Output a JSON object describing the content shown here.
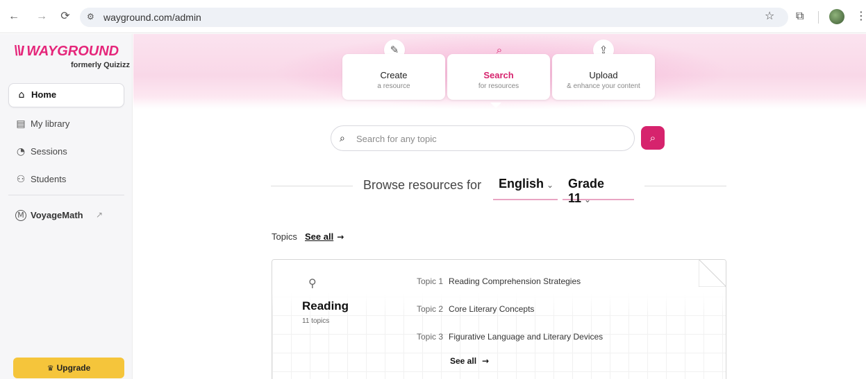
{
  "browser": {
    "url": "wayground.com/admin"
  },
  "brand": {
    "name": "WAYGROUND",
    "tagline": "formerly Quizizz",
    "accent": "#d6236d"
  },
  "sidebar": {
    "items": [
      {
        "label": "Home",
        "icon": "home-icon"
      },
      {
        "label": "My library",
        "icon": "library-icon"
      },
      {
        "label": "Sessions",
        "icon": "sessions-icon"
      },
      {
        "label": "Students",
        "icon": "students-icon"
      },
      {
        "label": "VoyageMath",
        "icon": "voyagemath-icon"
      }
    ],
    "upgrade_label": "Upgrade"
  },
  "actions": [
    {
      "title": "Create",
      "desc": "a resource",
      "icon": "pencil-icon"
    },
    {
      "title": "Search",
      "desc": "for resources",
      "icon": "search-icon"
    },
    {
      "title": "Upload",
      "desc": "& enhance your content",
      "icon": "upload-icon"
    }
  ],
  "search": {
    "placeholder": "Search for any topic"
  },
  "browse": {
    "label": "Browse resources for",
    "subject": "English",
    "grade": "Grade 11"
  },
  "topics": {
    "label": "Topics",
    "see_all": "See all",
    "card": {
      "subject": "Reading",
      "count": "11 topics",
      "rows": [
        {
          "num": "Topic 1",
          "name": "Reading Comprehension Strategies"
        },
        {
          "num": "Topic 2",
          "name": "Core Literary Concepts"
        },
        {
          "num": "Topic 3",
          "name": "Figurative Language and Literary Devices"
        }
      ],
      "see_all": "See all"
    }
  }
}
